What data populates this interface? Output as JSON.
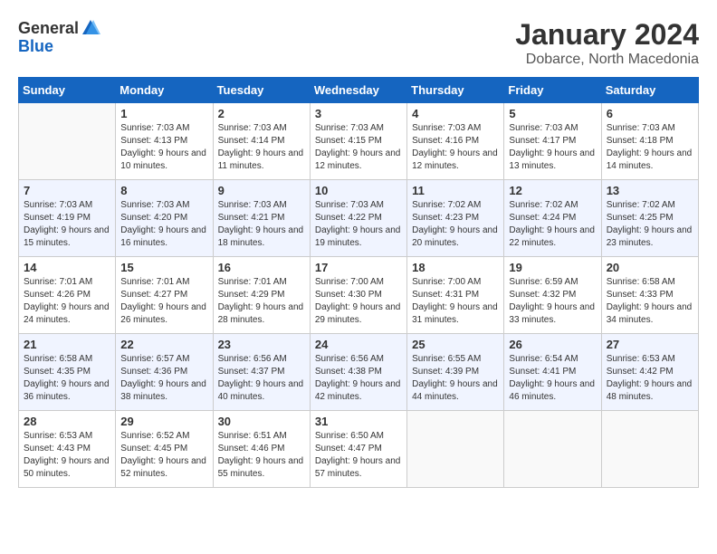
{
  "logo": {
    "general": "General",
    "blue": "Blue"
  },
  "title": "January 2024",
  "subtitle": "Dobarce, North Macedonia",
  "headers": [
    "Sunday",
    "Monday",
    "Tuesday",
    "Wednesday",
    "Thursday",
    "Friday",
    "Saturday"
  ],
  "weeks": [
    [
      {
        "day": "",
        "sunrise": "",
        "sunset": "",
        "daylight": ""
      },
      {
        "day": "1",
        "sunrise": "Sunrise: 7:03 AM",
        "sunset": "Sunset: 4:13 PM",
        "daylight": "Daylight: 9 hours and 10 minutes."
      },
      {
        "day": "2",
        "sunrise": "Sunrise: 7:03 AM",
        "sunset": "Sunset: 4:14 PM",
        "daylight": "Daylight: 9 hours and 11 minutes."
      },
      {
        "day": "3",
        "sunrise": "Sunrise: 7:03 AM",
        "sunset": "Sunset: 4:15 PM",
        "daylight": "Daylight: 9 hours and 12 minutes."
      },
      {
        "day": "4",
        "sunrise": "Sunrise: 7:03 AM",
        "sunset": "Sunset: 4:16 PM",
        "daylight": "Daylight: 9 hours and 12 minutes."
      },
      {
        "day": "5",
        "sunrise": "Sunrise: 7:03 AM",
        "sunset": "Sunset: 4:17 PM",
        "daylight": "Daylight: 9 hours and 13 minutes."
      },
      {
        "day": "6",
        "sunrise": "Sunrise: 7:03 AM",
        "sunset": "Sunset: 4:18 PM",
        "daylight": "Daylight: 9 hours and 14 minutes."
      }
    ],
    [
      {
        "day": "7",
        "sunrise": "Sunrise: 7:03 AM",
        "sunset": "Sunset: 4:19 PM",
        "daylight": "Daylight: 9 hours and 15 minutes."
      },
      {
        "day": "8",
        "sunrise": "Sunrise: 7:03 AM",
        "sunset": "Sunset: 4:20 PM",
        "daylight": "Daylight: 9 hours and 16 minutes."
      },
      {
        "day": "9",
        "sunrise": "Sunrise: 7:03 AM",
        "sunset": "Sunset: 4:21 PM",
        "daylight": "Daylight: 9 hours and 18 minutes."
      },
      {
        "day": "10",
        "sunrise": "Sunrise: 7:03 AM",
        "sunset": "Sunset: 4:22 PM",
        "daylight": "Daylight: 9 hours and 19 minutes."
      },
      {
        "day": "11",
        "sunrise": "Sunrise: 7:02 AM",
        "sunset": "Sunset: 4:23 PM",
        "daylight": "Daylight: 9 hours and 20 minutes."
      },
      {
        "day": "12",
        "sunrise": "Sunrise: 7:02 AM",
        "sunset": "Sunset: 4:24 PM",
        "daylight": "Daylight: 9 hours and 22 minutes."
      },
      {
        "day": "13",
        "sunrise": "Sunrise: 7:02 AM",
        "sunset": "Sunset: 4:25 PM",
        "daylight": "Daylight: 9 hours and 23 minutes."
      }
    ],
    [
      {
        "day": "14",
        "sunrise": "Sunrise: 7:01 AM",
        "sunset": "Sunset: 4:26 PM",
        "daylight": "Daylight: 9 hours and 24 minutes."
      },
      {
        "day": "15",
        "sunrise": "Sunrise: 7:01 AM",
        "sunset": "Sunset: 4:27 PM",
        "daylight": "Daylight: 9 hours and 26 minutes."
      },
      {
        "day": "16",
        "sunrise": "Sunrise: 7:01 AM",
        "sunset": "Sunset: 4:29 PM",
        "daylight": "Daylight: 9 hours and 28 minutes."
      },
      {
        "day": "17",
        "sunrise": "Sunrise: 7:00 AM",
        "sunset": "Sunset: 4:30 PM",
        "daylight": "Daylight: 9 hours and 29 minutes."
      },
      {
        "day": "18",
        "sunrise": "Sunrise: 7:00 AM",
        "sunset": "Sunset: 4:31 PM",
        "daylight": "Daylight: 9 hours and 31 minutes."
      },
      {
        "day": "19",
        "sunrise": "Sunrise: 6:59 AM",
        "sunset": "Sunset: 4:32 PM",
        "daylight": "Daylight: 9 hours and 33 minutes."
      },
      {
        "day": "20",
        "sunrise": "Sunrise: 6:58 AM",
        "sunset": "Sunset: 4:33 PM",
        "daylight": "Daylight: 9 hours and 34 minutes."
      }
    ],
    [
      {
        "day": "21",
        "sunrise": "Sunrise: 6:58 AM",
        "sunset": "Sunset: 4:35 PM",
        "daylight": "Daylight: 9 hours and 36 minutes."
      },
      {
        "day": "22",
        "sunrise": "Sunrise: 6:57 AM",
        "sunset": "Sunset: 4:36 PM",
        "daylight": "Daylight: 9 hours and 38 minutes."
      },
      {
        "day": "23",
        "sunrise": "Sunrise: 6:56 AM",
        "sunset": "Sunset: 4:37 PM",
        "daylight": "Daylight: 9 hours and 40 minutes."
      },
      {
        "day": "24",
        "sunrise": "Sunrise: 6:56 AM",
        "sunset": "Sunset: 4:38 PM",
        "daylight": "Daylight: 9 hours and 42 minutes."
      },
      {
        "day": "25",
        "sunrise": "Sunrise: 6:55 AM",
        "sunset": "Sunset: 4:39 PM",
        "daylight": "Daylight: 9 hours and 44 minutes."
      },
      {
        "day": "26",
        "sunrise": "Sunrise: 6:54 AM",
        "sunset": "Sunset: 4:41 PM",
        "daylight": "Daylight: 9 hours and 46 minutes."
      },
      {
        "day": "27",
        "sunrise": "Sunrise: 6:53 AM",
        "sunset": "Sunset: 4:42 PM",
        "daylight": "Daylight: 9 hours and 48 minutes."
      }
    ],
    [
      {
        "day": "28",
        "sunrise": "Sunrise: 6:53 AM",
        "sunset": "Sunset: 4:43 PM",
        "daylight": "Daylight: 9 hours and 50 minutes."
      },
      {
        "day": "29",
        "sunrise": "Sunrise: 6:52 AM",
        "sunset": "Sunset: 4:45 PM",
        "daylight": "Daylight: 9 hours and 52 minutes."
      },
      {
        "day": "30",
        "sunrise": "Sunrise: 6:51 AM",
        "sunset": "Sunset: 4:46 PM",
        "daylight": "Daylight: 9 hours and 55 minutes."
      },
      {
        "day": "31",
        "sunrise": "Sunrise: 6:50 AM",
        "sunset": "Sunset: 4:47 PM",
        "daylight": "Daylight: 9 hours and 57 minutes."
      },
      {
        "day": "",
        "sunrise": "",
        "sunset": "",
        "daylight": ""
      },
      {
        "day": "",
        "sunrise": "",
        "sunset": "",
        "daylight": ""
      },
      {
        "day": "",
        "sunrise": "",
        "sunset": "",
        "daylight": ""
      }
    ]
  ]
}
